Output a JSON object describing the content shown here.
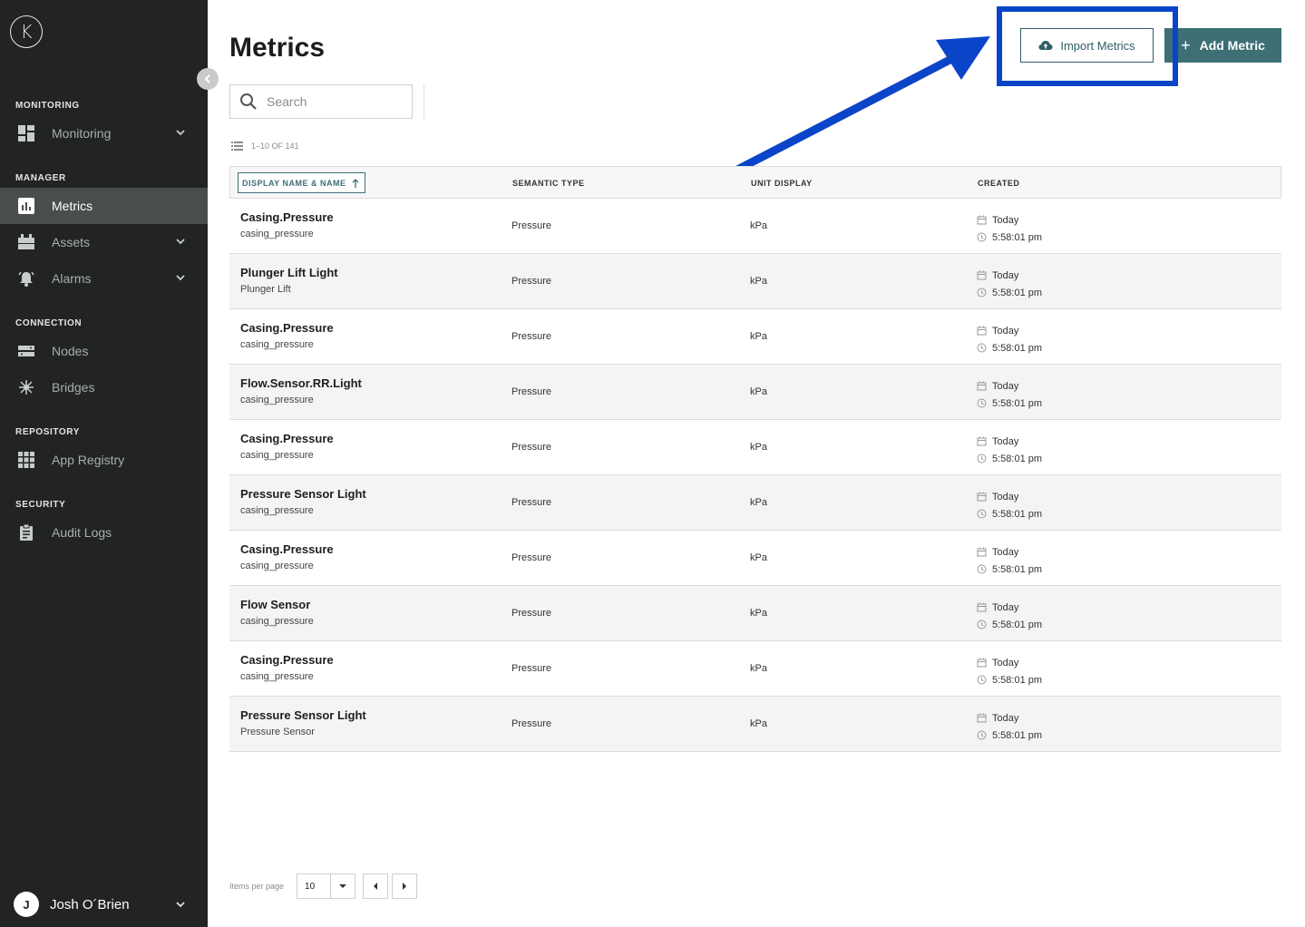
{
  "sidebar": {
    "logo_letter": "K",
    "sections": {
      "monitoring": "MONITORING",
      "manager": "MANAGER",
      "connection": "CONNECTION",
      "repository": "REPOSITORY",
      "security": "SECURITY"
    },
    "items": {
      "monitoring": "Monitoring",
      "metrics": "Metrics",
      "assets": "Assets",
      "alarms": "Alarms",
      "nodes": "Nodes",
      "bridges": "Bridges",
      "app_registry": "App Registry",
      "audit_logs": "Audit Logs"
    },
    "active_item": "Metrics",
    "user": {
      "initial": "J",
      "name": "Josh O´Brien"
    }
  },
  "header": {
    "title": "Metrics",
    "import_label": "Import Metrics",
    "add_label": "Add Metric",
    "add_plus": "+"
  },
  "search": {
    "placeholder": "Search",
    "value": ""
  },
  "count_label": "1–10 OF 141",
  "table": {
    "columns": [
      "DISPLAY NAME & NAME",
      "SEMANTIC TYPE",
      "UNIT DISPLAY",
      "CREATED"
    ],
    "rows": [
      {
        "display_name": "Casing.Pressure",
        "name": "casing_pressure",
        "semantic_type": "Pressure",
        "unit": "kPa",
        "date": "Today",
        "time": "5:58:01 pm"
      },
      {
        "display_name": "Plunger Lift Light",
        "name": "Plunger Lift",
        "semantic_type": "Pressure",
        "unit": "kPa",
        "date": "Today",
        "time": "5:58:01 pm"
      },
      {
        "display_name": "Casing.Pressure",
        "name": "casing_pressure",
        "semantic_type": "Pressure",
        "unit": "kPa",
        "date": "Today",
        "time": "5:58:01 pm"
      },
      {
        "display_name": "Flow.Sensor.RR.Light",
        "name": "casing_pressure",
        "semantic_type": "Pressure",
        "unit": "kPa",
        "date": "Today",
        "time": "5:58:01 pm"
      },
      {
        "display_name": "Casing.Pressure",
        "name": "casing_pressure",
        "semantic_type": "Pressure",
        "unit": "kPa",
        "date": "Today",
        "time": "5:58:01 pm"
      },
      {
        "display_name": "Pressure Sensor Light",
        "name": "casing_pressure",
        "semantic_type": "Pressure",
        "unit": "kPa",
        "date": "Today",
        "time": "5:58:01 pm"
      },
      {
        "display_name": "Casing.Pressure",
        "name": "casing_pressure",
        "semantic_type": "Pressure",
        "unit": "kPa",
        "date": "Today",
        "time": "5:58:01 pm"
      },
      {
        "display_name": "Flow Sensor",
        "name": "casing_pressure",
        "semantic_type": "Pressure",
        "unit": "kPa",
        "date": "Today",
        "time": "5:58:01 pm"
      },
      {
        "display_name": "Casing.Pressure",
        "name": "casing_pressure",
        "semantic_type": "Pressure",
        "unit": "kPa",
        "date": "Today",
        "time": "5:58:01 pm"
      },
      {
        "display_name": "Pressure Sensor Light",
        "name": "Pressure Sensor",
        "semantic_type": "Pressure",
        "unit": "kPa",
        "date": "Today",
        "time": "5:58:01 pm"
      }
    ]
  },
  "pagination": {
    "label": "Items per page",
    "per_page": "10"
  },
  "colors": {
    "sidebar_bg": "#222424",
    "accent": "#3d6f75",
    "highlight": "#0a45c9"
  },
  "icons": [
    "collapse-chevron-icon",
    "dashboard-icon",
    "chart-icon",
    "assets-icon",
    "alarm-bell-icon",
    "nodes-icon",
    "bridges-icon",
    "grid-icon",
    "clipboard-icon",
    "search-icon",
    "list-icon",
    "cloud-upload-icon",
    "sort-up-icon",
    "calendar-icon",
    "clock-icon",
    "caret-down-icon",
    "caret-left-icon",
    "caret-right-icon",
    "annotation-arrow-icon"
  ]
}
